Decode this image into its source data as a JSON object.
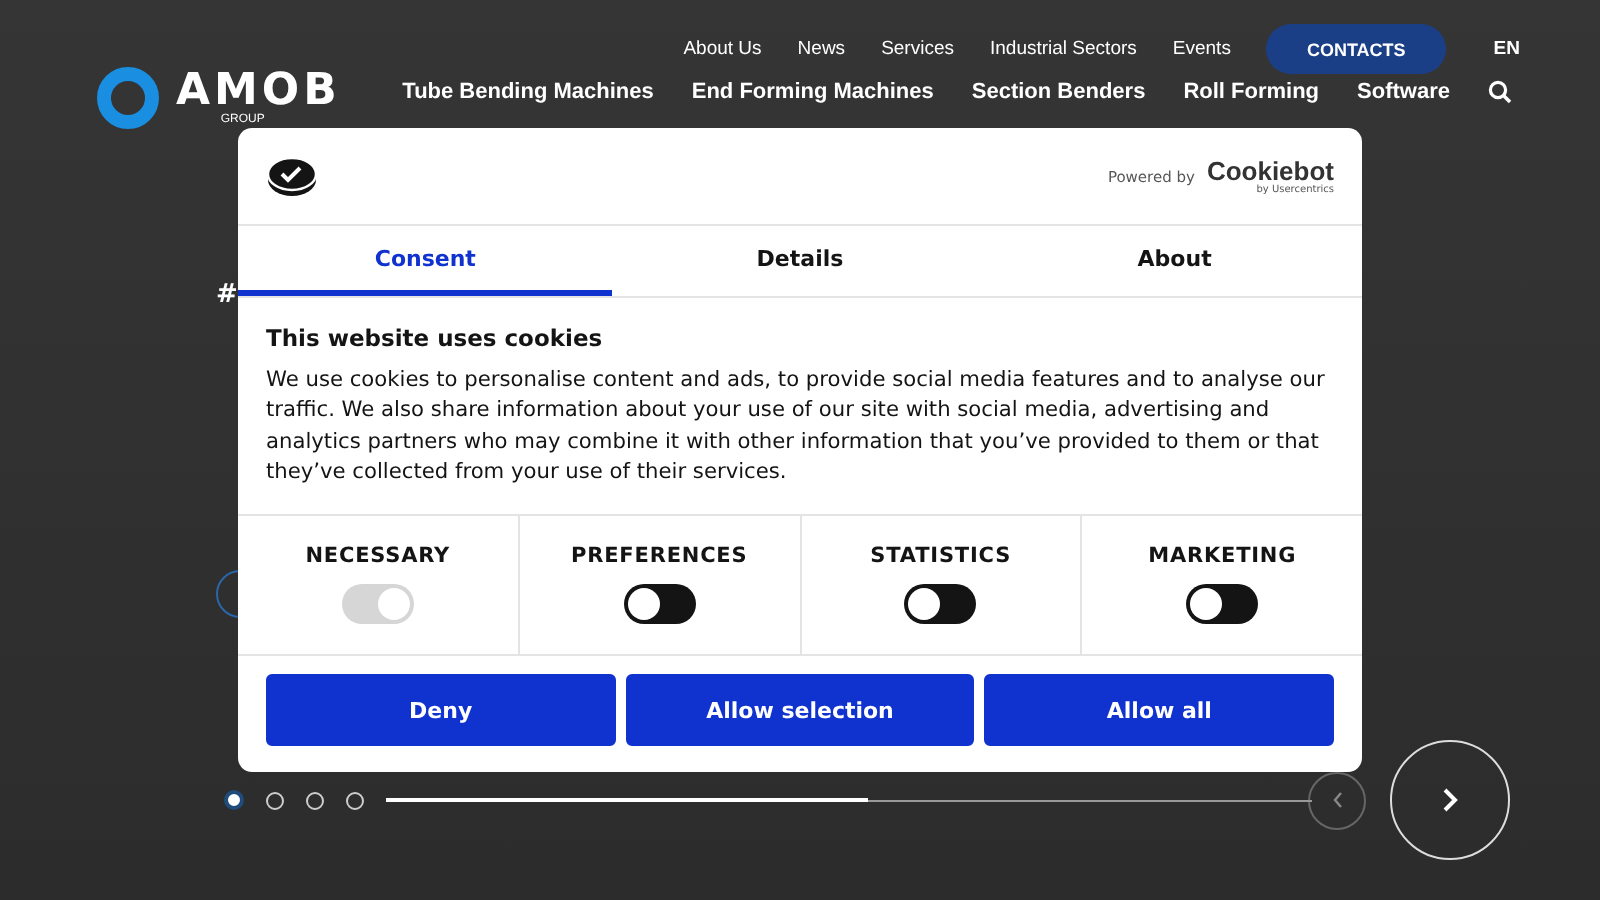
{
  "header": {
    "logo": {
      "name": "AMOB",
      "sub": "GROUP"
    },
    "top_links": [
      "About Us",
      "News",
      "Services",
      "Industrial Sectors",
      "Events"
    ],
    "contacts_button": "CONTACTS",
    "language": "EN",
    "main_nav": [
      "Tube Bending Machines",
      "End Forming Machines",
      "Section Benders",
      "Roll Forming",
      "Software"
    ]
  },
  "hero": {
    "tag": "#"
  },
  "dialog": {
    "powered_by": "Powered by",
    "brand": "Cookiebot",
    "brand_sub": "by Usercentrics",
    "tabs": [
      {
        "label": "Consent",
        "selected": true
      },
      {
        "label": "Details",
        "selected": false
      },
      {
        "label": "About",
        "selected": false
      }
    ],
    "title": "This website uses cookies",
    "text": "We use cookies to personalise content and ads, to provide social media features and to analyse our traffic. We also share information about your use of our site with social media, advertising and analytics partners who may combine it with other information that you’ve provided to them or that they’ve collected from your use of their services.",
    "categories": [
      {
        "label": "NECESSARY",
        "checked": true,
        "disabled": true
      },
      {
        "label": "PREFERENCES",
        "checked": false,
        "disabled": false
      },
      {
        "label": "STATISTICS",
        "checked": false,
        "disabled": false
      },
      {
        "label": "MARKETING",
        "checked": false,
        "disabled": false
      }
    ],
    "buttons": [
      "Deny",
      "Allow selection",
      "Allow all"
    ]
  },
  "slider": {
    "dots": [
      {
        "selected": true
      },
      {
        "selected": false
      },
      {
        "selected": false
      },
      {
        "selected": false
      }
    ],
    "progress": {
      "level": 0.52
    }
  }
}
